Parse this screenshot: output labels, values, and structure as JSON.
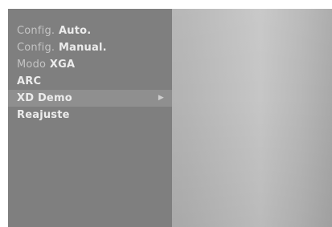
{
  "menu": {
    "items": [
      {
        "label_dim": "Config.",
        "label_main": "Auto."
      },
      {
        "label_dim": "Config.",
        "label_main": "Manual."
      },
      {
        "label_dim": "Modo",
        "label_main": "XGA"
      },
      {
        "label_dim": "",
        "label_main": "ARC"
      },
      {
        "label_dim": "",
        "label_main": "XD Demo",
        "submenu_arrow": "▶"
      },
      {
        "label_dim": "",
        "label_main": "Reajuste"
      }
    ],
    "selected_index": 4
  },
  "icons": {
    "submenu": "triangle-right-icon"
  }
}
